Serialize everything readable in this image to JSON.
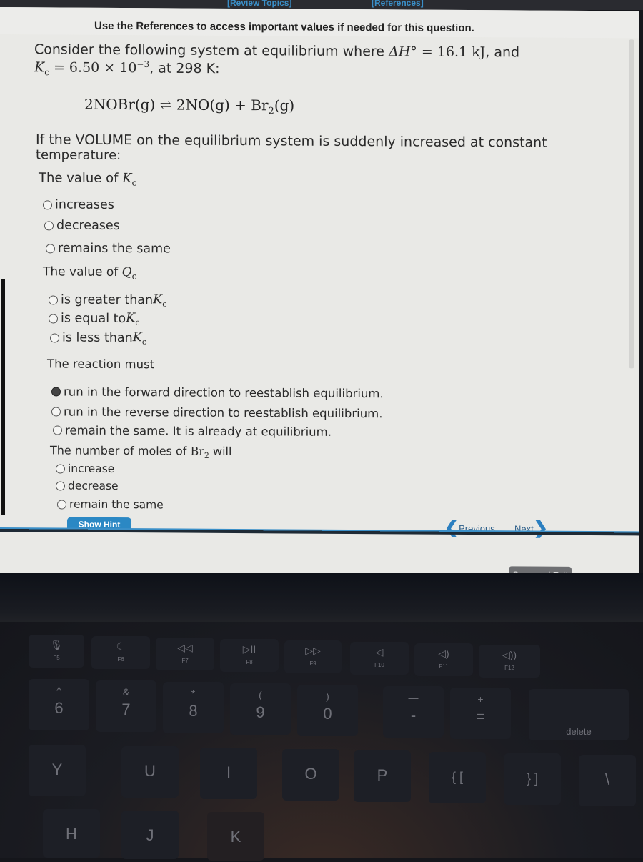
{
  "top_links": {
    "review_topics": "[Review Topics]",
    "references": "[References]"
  },
  "ref_note": "Use the References to access important values if needed for this question.",
  "question": {
    "intro_line1_prefix": "Consider the following system at equilibrium where ",
    "delta_h_symbol": "ΔH°",
    "delta_h_value": " = 16.1 kJ",
    "intro_line1_suffix": ", and",
    "kc_symbol": "K",
    "kc_sub": "c",
    "kc_value": " = 6.50 × 10",
    "kc_exp": "−3",
    "kc_suffix": ", at 298 K:",
    "equation_left": "2NOBr(g)",
    "equation_arrow": "⇌",
    "equation_right_1": "2NO(g) + Br",
    "equation_right_sub": "2",
    "equation_right_2": "(g)",
    "condition_line1": "If the VOLUME on the equilibrium system is suddenly increased at constant",
    "condition_line2": "temperature:"
  },
  "parts": [
    {
      "prompt": "The value of ",
      "symbol": "K",
      "sub": "c",
      "options": [
        {
          "label": "increases",
          "selected": false
        },
        {
          "label": "decreases",
          "selected": false
        },
        {
          "label": "remains the same",
          "selected": false
        }
      ]
    },
    {
      "prompt": "The value of ",
      "symbol": "Q",
      "sub": "c",
      "options": [
        {
          "label": "is greater than ",
          "symbol": "K",
          "sub": "c",
          "selected": false
        },
        {
          "label": "is equal to ",
          "symbol": "K",
          "sub": "c",
          "selected": false
        },
        {
          "label": "is less than ",
          "symbol": "K",
          "sub": "c",
          "selected": false
        }
      ]
    },
    {
      "prompt": "The reaction must",
      "options": [
        {
          "label": "run in the forward direction to reestablish equilibrium.",
          "selected": false,
          "cursor_over": true
        },
        {
          "label": "run in the reverse direction to reestablish equilibrium.",
          "selected": false
        },
        {
          "label": "remain the same. It is already at equilibrium.",
          "selected": false
        }
      ]
    },
    {
      "prompt": "The number of moles of ",
      "symbol": "Br",
      "sub": "2",
      "prompt_suffix": " will",
      "options": [
        {
          "label": "increase",
          "selected": false
        },
        {
          "label": "decrease",
          "selected": false
        },
        {
          "label": "remain the same",
          "selected": false
        }
      ]
    }
  ],
  "buttons": {
    "show_hint": "Show Hint",
    "previous": "Previous",
    "next": "Next",
    "save_exit": "Save and Exit"
  },
  "colors": {
    "accent": "#2b88c4",
    "nav_text": "#2d5f8a",
    "save_bg": "#6e6f72"
  },
  "keyboard": {
    "fkeys": [
      {
        "label": "F5",
        "icon": "mic-icon",
        "glyph": "🎙"
      },
      {
        "label": "F6",
        "icon": "moon-icon",
        "glyph": "☾"
      },
      {
        "label": "F7",
        "icon": "rewind-icon",
        "glyph": "◁◁"
      },
      {
        "label": "F8",
        "icon": "play-pause-icon",
        "glyph": "▷II"
      },
      {
        "label": "F9",
        "icon": "fast-forward-icon",
        "glyph": "▷▷"
      },
      {
        "label": "F10",
        "icon": "mute-icon",
        "glyph": "◁"
      },
      {
        "label": "F11",
        "icon": "volume-down-icon",
        "glyph": "◁)"
      },
      {
        "label": "F12",
        "icon": "volume-up-icon",
        "glyph": "◁))"
      }
    ],
    "numkeys": [
      {
        "top": "^",
        "bottom": "6"
      },
      {
        "top": "&",
        "bottom": "7"
      },
      {
        "top": "*",
        "bottom": "8"
      },
      {
        "top": "(",
        "bottom": "9"
      },
      {
        "top": ")",
        "bottom": "0"
      },
      {
        "top": "—",
        "bottom": "-"
      },
      {
        "top": "+",
        "bottom": "="
      }
    ],
    "delete": "delete",
    "row_qwerty": [
      "Y",
      "U",
      "I",
      "O",
      "P",
      "{ [",
      "} ]",
      "\\"
    ],
    "row_home": [
      "H",
      "J",
      "K"
    ]
  }
}
